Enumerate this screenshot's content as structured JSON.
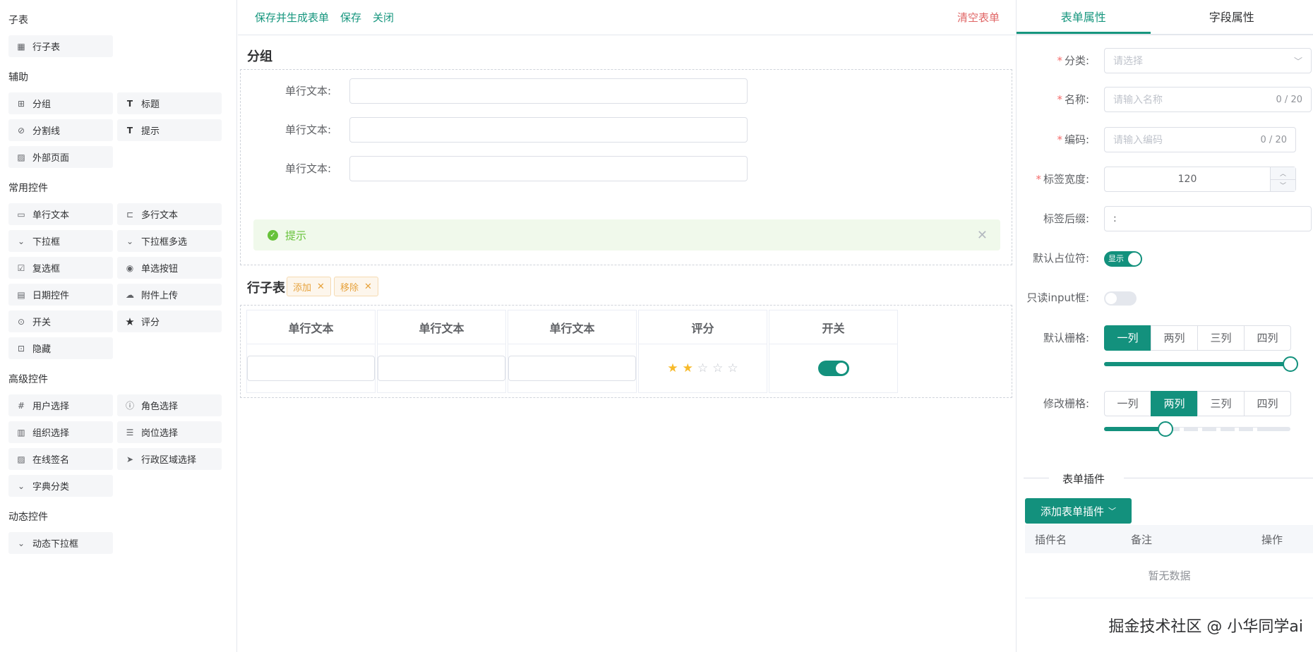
{
  "left": {
    "groups": [
      {
        "title": "子表",
        "items": [
          {
            "label": "行子表",
            "icon": "table-icon"
          }
        ]
      },
      {
        "title": "辅助",
        "items": [
          {
            "label": "分组",
            "icon": "grid-icon"
          },
          {
            "label": "标题",
            "icon": "text-icon"
          },
          {
            "label": "分割线",
            "icon": "link-icon"
          },
          {
            "label": "提示",
            "icon": "text-icon"
          },
          {
            "label": "外部页面",
            "icon": "image-icon"
          }
        ]
      },
      {
        "title": "常用控件",
        "items": [
          {
            "label": "单行文本",
            "icon": "input-icon"
          },
          {
            "label": "多行文本",
            "icon": "textarea-icon"
          },
          {
            "label": "下拉框",
            "icon": "select-icon"
          },
          {
            "label": "下拉框多选",
            "icon": "select-icon"
          },
          {
            "label": "复选框",
            "icon": "checkbox-icon"
          },
          {
            "label": "单选按钮",
            "icon": "radio-icon"
          },
          {
            "label": "日期控件",
            "icon": "calendar-icon"
          },
          {
            "label": "附件上传",
            "icon": "upload-icon"
          },
          {
            "label": "开关",
            "icon": "switch-icon"
          },
          {
            "label": "评分",
            "icon": "star-icon"
          },
          {
            "label": "隐藏",
            "icon": "lock-icon"
          }
        ]
      },
      {
        "title": "高级控件",
        "items": [
          {
            "label": "用户选择",
            "icon": "number-icon"
          },
          {
            "label": "角色选择",
            "icon": "info-icon"
          },
          {
            "label": "组织选择",
            "icon": "org-icon"
          },
          {
            "label": "岗位选择",
            "icon": "sliders-icon"
          },
          {
            "label": "在线签名",
            "icon": "image-icon"
          },
          {
            "label": "行政区域选择",
            "icon": "location-icon"
          },
          {
            "label": "字典分类",
            "icon": "select-icon"
          }
        ]
      },
      {
        "title": "动态控件",
        "items": [
          {
            "label": "动态下拉框",
            "icon": "select-icon"
          }
        ]
      }
    ]
  },
  "toolbar": {
    "save_generate": "保存并生成表单",
    "save": "保存",
    "close": "关闭",
    "clear": "清空表单"
  },
  "canvas": {
    "group_title": "分组",
    "rows": [
      {
        "label": "单行文本:"
      },
      {
        "label": "单行文本:"
      },
      {
        "label": "单行文本:"
      }
    ],
    "alert": "提示",
    "subtable_title": "行子表",
    "add_label": "添加",
    "remove_label": "移除",
    "columns": [
      "单行文本",
      "单行文本",
      "单行文本",
      "评分",
      "开关"
    ],
    "rating": {
      "value": 2,
      "max": 5
    }
  },
  "right": {
    "tabs": [
      "表单属性",
      "字段属性"
    ],
    "category": {
      "label": "分类:",
      "placeholder": "请选择"
    },
    "name": {
      "label": "名称:",
      "placeholder": "请输入名称",
      "count": "0 / 20"
    },
    "code": {
      "label": "编码:",
      "placeholder": "请输入编码",
      "count": "0 / 20"
    },
    "label_width": {
      "label": "标签宽度:",
      "value": "120"
    },
    "label_suffix": {
      "label": "标签后缀:",
      "value": ":"
    },
    "placeholder_toggle": {
      "label": "默认占位符:",
      "text": "显示"
    },
    "readonly": {
      "label": "只读input框:"
    },
    "default_grid": {
      "label": "默认栅格:",
      "options": [
        "一列",
        "两列",
        "三列",
        "四列"
      ],
      "selected": 0,
      "level": 1.0
    },
    "modify_grid": {
      "label": "修改栅格:",
      "options": [
        "一列",
        "两列",
        "三列",
        "四列"
      ],
      "selected": 1,
      "level": 0.33
    },
    "plugins": {
      "divider": "表单插件",
      "add_button": "添加表单插件",
      "headers": [
        "插件名",
        "备注",
        "操作"
      ],
      "empty": "暂无数据"
    },
    "watermark": "掘金技术社区 @ 小华同学ai"
  },
  "colors": {
    "accent": "#13917d",
    "danger": "#e06666",
    "warning": "#e6a23c",
    "success": "#67c23a"
  }
}
